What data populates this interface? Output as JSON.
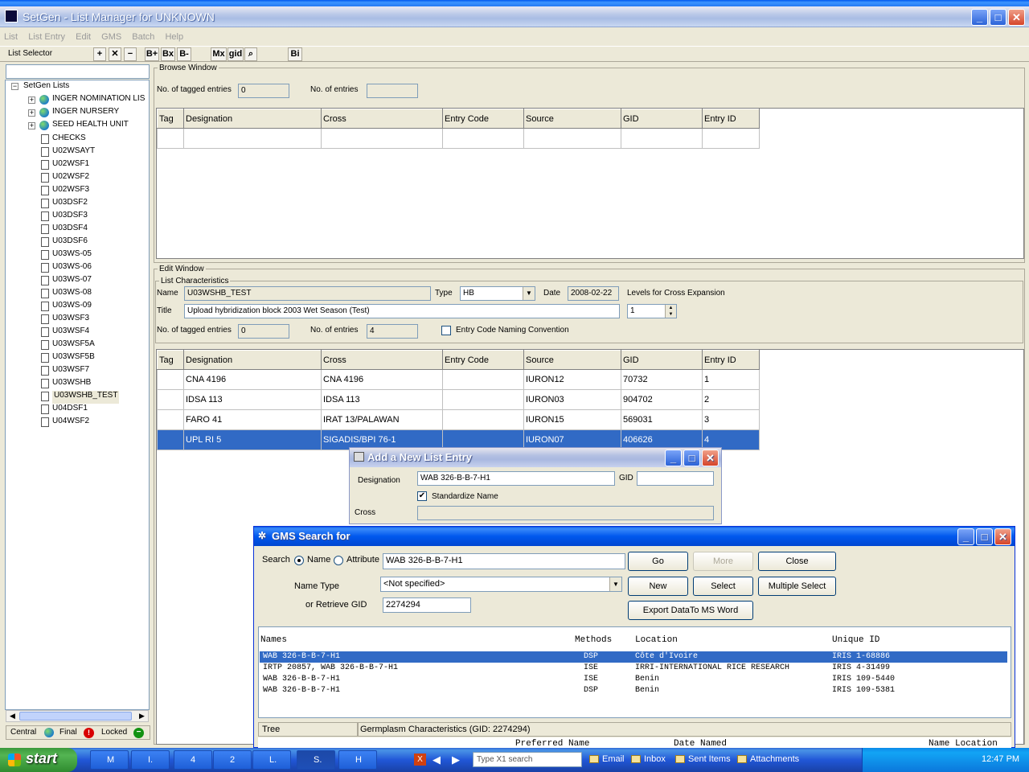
{
  "app": {
    "title": "SetGen - List Manager for UNKNOWN"
  },
  "menu": [
    "List",
    "List Entry",
    "Edit",
    "GMS",
    "Batch",
    "Help"
  ],
  "toolbar": {
    "list_selector": "List Selector",
    "b_plus": "B+",
    "bx": "Bx",
    "b_minus": "B-",
    "mx": "Mx",
    "gid": "gid",
    "bi": "Bi"
  },
  "tree": {
    "root": "SetGen Lists",
    "groups": [
      "INGER NOMINATION LIS",
      "INGER NURSERY",
      "SEED HEALTH UNIT"
    ],
    "items": [
      "CHECKS",
      "U02WSAYT",
      "U02WSF1",
      "U02WSF2",
      "U02WSF3",
      "U03DSF2",
      "U03DSF3",
      "U03DSF4",
      "U03DSF6",
      "U03WS-05",
      "U03WS-06",
      "U03WS-07",
      "U03WS-08",
      "U03WS-09",
      "U03WSF3",
      "U03WSF4",
      "U03WSF5A",
      "U03WSF5B",
      "U03WSF7",
      "U03WSHB",
      "U03WSHB_TEST",
      "U04DSF1",
      "U04WSF2"
    ],
    "selected": "U03WSHB_TEST"
  },
  "status_legend": {
    "central": "Central",
    "final": "Final",
    "locked": "Locked"
  },
  "browse": {
    "title": "Browse Window",
    "tagged_label": "No. of tagged entries",
    "tagged_value": "0",
    "entries_label": "No. of entries",
    "entries_value": "",
    "columns": [
      "Tag",
      "Designation",
      "Cross",
      "Entry Code",
      "Source",
      "GID",
      "Entry ID"
    ]
  },
  "edit": {
    "title": "Edit Window",
    "list_char": "List Characteristics",
    "name_label": "Name",
    "name_value": "U03WSHB_TEST",
    "type_label": "Type",
    "type_value": "HB",
    "date_label": "Date",
    "date_value": "2008-02-22",
    "levels_label": "Levels for Cross Expansion",
    "levels_value": "1",
    "title_label": "Title",
    "title_value": "Upload hybridization block 2003 Wet Season (Test)",
    "tagged_label": "No. of tagged entries",
    "tagged_value": "0",
    "entries_label": "No. of entries",
    "entries_value": "4",
    "naming_label": "Entry Code Naming Convention",
    "columns": [
      "Tag",
      "Designation",
      "Cross",
      "Entry Code",
      "Source",
      "GID",
      "Entry ID"
    ],
    "rows": [
      {
        "tag": "",
        "designation": "CNA 4196",
        "cross": "CNA 4196",
        "entry_code": "",
        "source": "IURON12",
        "gid": "70732",
        "entry_id": "1"
      },
      {
        "tag": "",
        "designation": "IDSA 113",
        "cross": "IDSA 113",
        "entry_code": "",
        "source": "IURON03",
        "gid": "904702",
        "entry_id": "2"
      },
      {
        "tag": "",
        "designation": "FARO 41",
        "cross": "IRAT 13/PALAWAN",
        "entry_code": "",
        "source": "IURON15",
        "gid": "569031",
        "entry_id": "3"
      },
      {
        "tag": "",
        "designation": "UPL RI 5",
        "cross": "SIGADIS/BPI 76-1",
        "entry_code": "",
        "source": "IURON07",
        "gid": "406626",
        "entry_id": "4"
      }
    ]
  },
  "add_dialog": {
    "title": "Add a New List Entry",
    "designation_label": "Designation",
    "designation_value": "WAB 326-B-B-7-H1",
    "gid_label": "GID",
    "gid_value": "",
    "standardize_label": "Standardize Name",
    "cross_label": "Cross"
  },
  "gms_dialog": {
    "title": "GMS Search for",
    "search_label": "Search",
    "name_radio": "Name",
    "attribute_radio": "Attribute",
    "search_value": "WAB 326-B-B-7-H1",
    "name_type_label": "Name Type",
    "name_type_value": "<Not specified>",
    "retrieve_label": "or Retrieve GID",
    "retrieve_value": "2274294",
    "buttons": {
      "go": "Go",
      "more": "More",
      "close": "Close",
      "new": "New",
      "select": "Select",
      "multiple": "Multiple Select",
      "export": "Export DataTo MS Word"
    },
    "columns": {
      "names": "Names",
      "methods": "Methods",
      "location": "Location",
      "uid": "Unique ID"
    },
    "results": [
      {
        "name": "WAB 326-B-B-7-H1",
        "method": "DSP",
        "location": "Côte d'Ivoire",
        "uid": "IRIS 1-68886"
      },
      {
        "name": "IRTP 20857, WAB 326-B-B-7-H1",
        "method": "ISE",
        "location": "IRRI-INTERNATIONAL RICE RESEARCH",
        "uid": "IRIS 4-31499"
      },
      {
        "name": "WAB 326-B-B-7-H1",
        "method": "ISE",
        "location": "Benin",
        "uid": "IRIS 109-5440"
      },
      {
        "name": "WAB 326-B-B-7-H1",
        "method": "DSP",
        "location": "Benin",
        "uid": "IRIS 109-5381"
      }
    ],
    "tree_label": "Tree",
    "germplasm_label": "Germplasm Characteristics (GID: 2274294)",
    "bottom_cols": {
      "preferred": "Preferred Name",
      "date": "Date Named",
      "loc": "Name Location"
    }
  },
  "taskbar": {
    "start": "start",
    "items": [
      "M",
      "I.",
      "4",
      "2",
      "L.",
      "S.",
      "H"
    ],
    "search_placeholder": "Type X1 search",
    "links": [
      "Email",
      "Inbox",
      "Sent Items",
      "Attachments"
    ],
    "time": "12:47 PM"
  }
}
